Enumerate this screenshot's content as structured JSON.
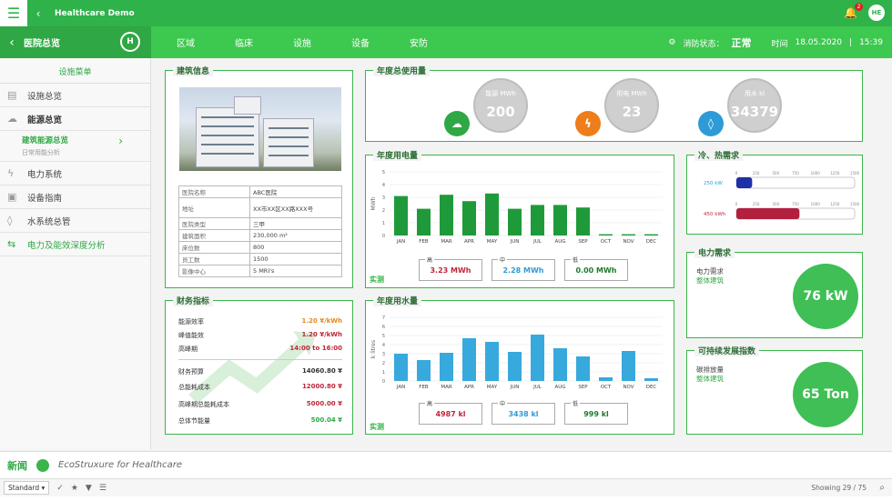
{
  "topbar": {
    "title": "Healthcare Demo",
    "bell_count": "2",
    "avatar": "HE"
  },
  "nav": {
    "section": "医院总览",
    "logo": "H",
    "tabs": [
      "区域",
      "临床",
      "设施",
      "设备",
      "安防"
    ],
    "alarm_label": "消防状态：",
    "alarm_value": "正常",
    "time_label": "时间",
    "date": "18.05.2020",
    "time": "15:39"
  },
  "sidebar": {
    "header": "设施菜单",
    "items": [
      {
        "label": "设施总览",
        "icon": "document-icon"
      },
      {
        "label": "能源总览",
        "icon": "cloud-icon"
      }
    ],
    "sub": {
      "title": "建筑能源总览",
      "subtitle": "日常用能分析"
    },
    "more": [
      {
        "label": "电力系统",
        "icon": "lightning-icon"
      },
      {
        "label": "设备指南",
        "icon": "manual-icon"
      },
      {
        "label": "水系统总管",
        "icon": "drop-icon"
      },
      {
        "label": "电力及能效深度分析",
        "icon": "analysis-icon"
      }
    ]
  },
  "building": {
    "title": "建筑信息",
    "rows": [
      {
        "k": "医院名称",
        "v": "ABC医院"
      },
      {
        "k": "地址",
        "v": "XX市XX区XX路XXX号"
      },
      {
        "k": "医院类型",
        "v": "三甲"
      },
      {
        "k": "建筑面积",
        "v": "230,000 m²"
      },
      {
        "k": "床位数",
        "v": "800"
      },
      {
        "k": "员工数",
        "v": "1500"
      },
      {
        "k": "影像中心",
        "v": "5 MRI's"
      }
    ]
  },
  "finance": {
    "title": "财务指标",
    "rows": [
      {
        "k": "能源效率",
        "v": "1.20 ¥/kWh",
        "color": "#e08a1e"
      },
      {
        "k": "峰值能效",
        "v": "1.20 ¥/kWh",
        "color": "#c0263a"
      },
      {
        "k": "高峰期",
        "v": "14:00 to 16:00",
        "color": "#c0263a"
      },
      {
        "k": "财务预算",
        "v": "14060.80 ¥",
        "color": "#333"
      },
      {
        "k": "总能耗成本",
        "v": "12000.80 ¥",
        "color": "#c0263a"
      },
      {
        "k": "高峰期总能耗成本",
        "v": "5000.00 ¥",
        "color": "#c0263a"
      },
      {
        "k": "总体节能量",
        "v": "500.04 ¥",
        "color": "#2fa744"
      }
    ]
  },
  "annual": {
    "title": "年度总使用量",
    "items": [
      {
        "label": "能源 MWh",
        "value": "200",
        "icon": "cloud-icon",
        "color": "#2fa744"
      },
      {
        "label": "用电 MWh",
        "value": "23",
        "icon": "lightning-icon",
        "color": "#ee7d1b"
      },
      {
        "label": "用水 kl",
        "value": "34379",
        "icon": "drop-icon",
        "color": "#2e9bd6"
      }
    ]
  },
  "power_chart": {
    "title": "年度用电量",
    "real_label": "实测",
    "chart_data": {
      "type": "bar",
      "ylabel": "MWh",
      "ylim": [
        0,
        5
      ],
      "yticks": [
        "5",
        "4",
        "3",
        "2",
        "1",
        "0"
      ],
      "categories": [
        "JAN",
        "FEB",
        "MAR",
        "APR",
        "MAY",
        "JUN",
        "JUL",
        "AUG",
        "SEP",
        "OCT",
        "NOV",
        "DEC"
      ],
      "values": [
        3.1,
        2.1,
        3.2,
        2.7,
        3.3,
        2.1,
        2.4,
        2.4,
        2.2,
        0.1,
        0.1,
        0.1
      ],
      "color": "#1f9a3a"
    },
    "stats": [
      {
        "cap": "高",
        "value": "3.23 MWh",
        "color": "#c0263a"
      },
      {
        "cap": "中",
        "value": "2.28 MWh",
        "color": "#2e9bd6"
      },
      {
        "cap": "低",
        "value": "0.00 MWh",
        "color": "#1f7a2e"
      }
    ]
  },
  "water_chart": {
    "title": "年度用水量",
    "real_label": "实测",
    "chart_data": {
      "type": "bar",
      "ylabel": "k litres",
      "ylim": [
        0,
        7
      ],
      "yticks": [
        "7",
        "6",
        "5",
        "4",
        "3",
        "2",
        "1",
        "0"
      ],
      "categories": [
        "JAN",
        "FEB",
        "MAR",
        "APR",
        "MAY",
        "JUN",
        "JUL",
        "AUG",
        "SEP",
        "OCT",
        "NOV",
        "DEC"
      ],
      "values": [
        3.0,
        2.3,
        3.1,
        4.7,
        4.3,
        3.2,
        5.1,
        3.6,
        2.7,
        0.4,
        3.3,
        0.3
      ],
      "color": "#38a9dc"
    },
    "stats": [
      {
        "cap": "高",
        "value": "4987 kl",
        "color": "#c0263a"
      },
      {
        "cap": "中",
        "value": "3438 kl",
        "color": "#2e9bd6"
      },
      {
        "cap": "低",
        "value": "999 kl",
        "color": "#1f7a2e"
      }
    ]
  },
  "hvac": {
    "title": "冷、热需求",
    "ticks": [
      "0",
      "250",
      "500",
      "750",
      "1000",
      "1250",
      "1500"
    ],
    "bars": [
      {
        "label": "250 kW",
        "value": 200,
        "max": 1500,
        "color": "#1f2fa8",
        "label_color": "#2e9bd6"
      },
      {
        "label": "450 kWh",
        "value": 800,
        "max": 1500,
        "color": "#b3203e",
        "label_color": "#c0263a"
      }
    ]
  },
  "power_demand": {
    "title": "电力需求",
    "line1": "电力需求",
    "line2": "整体建筑",
    "value": "76 kW"
  },
  "sustain": {
    "title": "可持续发展指数",
    "line1": "碳排放量",
    "line2": "整体建筑",
    "value": "65 Ton"
  },
  "bottom": {
    "news": "新闻",
    "brand": "EcoStruxure for Healthcare",
    "standard": "Standard",
    "showing": "Showing 29 / 75"
  }
}
